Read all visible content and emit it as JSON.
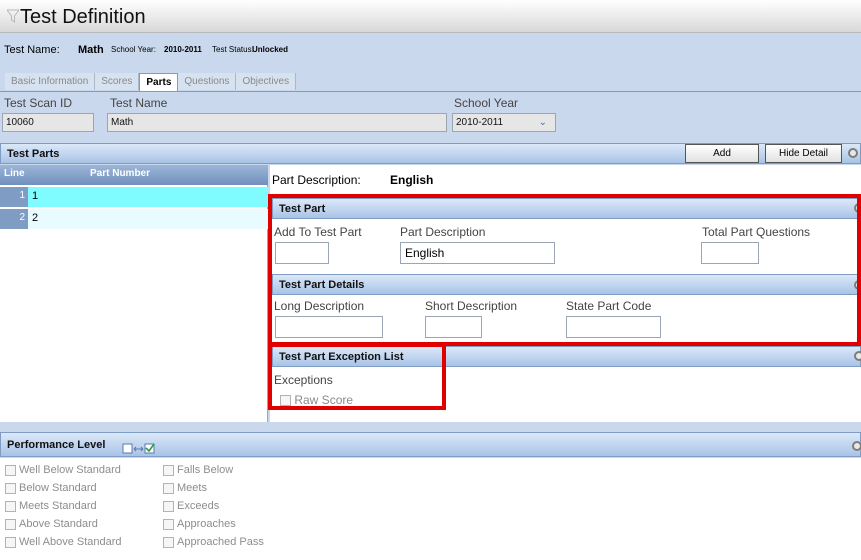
{
  "title": "Test Definition",
  "info": {
    "test_name_label": "Test Name:",
    "test_name_value": "Math",
    "school_year_label": "School Year:",
    "school_year_value": "2010-2011",
    "test_status_label": "Test Status:",
    "test_status_value": "Unlocked"
  },
  "tabs": [
    "Basic Information",
    "Scores",
    "Parts",
    "Questions",
    "Objectives"
  ],
  "active_tab": "Parts",
  "fields": {
    "scan_id_label": "Test Scan ID",
    "scan_id_value": "10060",
    "test_name_label": "Test Name",
    "test_name_value": "Math",
    "school_year_label": "School Year",
    "school_year_value": "2010-2011"
  },
  "test_parts": {
    "header": "Test Parts",
    "add_label": "Add",
    "hide_detail_label": "Hide Detail",
    "columns": [
      "Line",
      "Part Number"
    ],
    "rows": [
      {
        "line": "1",
        "part": "1"
      },
      {
        "line": "2",
        "part": "2"
      }
    ]
  },
  "detail": {
    "part_description_label": "Part Description:",
    "part_description_value": "English",
    "test_part_header": "Test Part",
    "add_to_test_part_label": "Add To Test Part",
    "part_description_field_label": "Part Description",
    "part_description_field_value": "English",
    "total_part_questions_label": "Total Part Questions",
    "details_header": "Test Part Details",
    "long_description_label": "Long Description",
    "short_description_label": "Short Description",
    "state_part_code_label": "State Part Code",
    "exception_header": "Test Part Exception List",
    "exceptions_label": "Exceptions",
    "raw_score_label": "Raw Score"
  },
  "performance": {
    "header": "Performance Level",
    "col1": [
      "Well Below Standard",
      "Below Standard",
      "Meets Standard",
      "Above Standard",
      "Well Above Standard"
    ],
    "col2": [
      "Falls Below",
      "Meets",
      "Exceeds",
      "Approaches",
      "Approached Pass"
    ]
  },
  "colors": {
    "accent_blue": "#a9c3e6",
    "selected_row": "#7ffcff",
    "highlight_red": "#e00000"
  }
}
